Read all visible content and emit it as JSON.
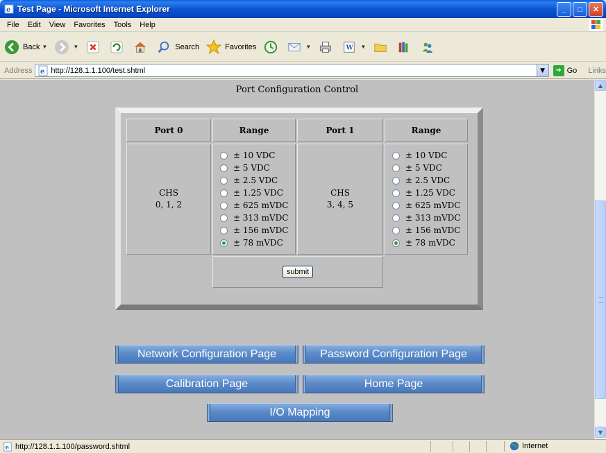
{
  "window": {
    "title": "Test Page - Microsoft Internet Explorer"
  },
  "menu": [
    "File",
    "Edit",
    "View",
    "Favorites",
    "Tools",
    "Help"
  ],
  "toolbar": {
    "back_label": "Back",
    "search_label": "Search",
    "favorites_label": "Favorites"
  },
  "address": {
    "label": "Address",
    "url": "http://128.1.1.100/test.shtml",
    "go_label": "Go",
    "links_label": "Links"
  },
  "page": {
    "heading": "Port Configuration Control",
    "table": {
      "headers": [
        "Port 0",
        "Range",
        "Port 1",
        "Range"
      ],
      "port0_chs": [
        "CHS",
        "0, 1, 2"
      ],
      "port1_chs": [
        "CHS",
        "3, 4, 5"
      ],
      "ranges": [
        "± 10 VDC",
        "± 5 VDC",
        "± 2.5 VDC",
        "± 1.25 VDC",
        "± 625 mVDC",
        "± 313 mVDC",
        "± 156 mVDC",
        "± 78 mVDC"
      ],
      "port0_selected": "± 78 mVDC",
      "port1_selected": "± 78 mVDC"
    },
    "submit_label": "submit",
    "nav": {
      "network": "Network Configuration Page",
      "password": "Password Configuration Page",
      "calibration": "Calibration Page",
      "home": "Home Page",
      "io": "I/O Mapping"
    }
  },
  "status": {
    "text": "http://128.1.1.100/password.shtml",
    "zone": "Internet"
  }
}
